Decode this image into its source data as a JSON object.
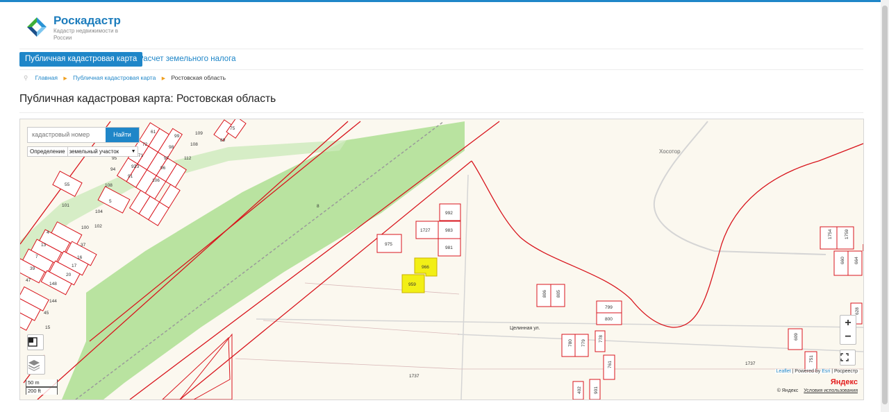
{
  "header": {
    "brand": "Роскадастр",
    "brand_sub": "Кадастр недвижимости в России"
  },
  "tabs": [
    {
      "label": "Публичная кадастровая карта",
      "active": true
    },
    {
      "label": "Расчет земельного налога",
      "active": false
    }
  ],
  "breadcrumb": [
    "Главная",
    "Публичная кадастровая карта",
    "Ростовская область"
  ],
  "page_title": "Публичная кадастровая карта: Ростовская область",
  "map": {
    "search": {
      "placeholder": "кадастровый номер",
      "button": "Найти"
    },
    "define": {
      "label": "Определение",
      "value": "земельный участок"
    },
    "zoom_in": "+",
    "zoom_out": "−",
    "scale_metric": "50 m",
    "scale_imperial": "200 ft",
    "attribution": {
      "leaflet": "Leaflet",
      "sep1": " | Powered by ",
      "esri": "Esri",
      "sep2": " | Росреестр"
    },
    "yandex_logo": "Яндекс",
    "yandex_copy": "© Яндекс",
    "yandex_terms": "Условия использования",
    "place_khosotor": "Хосотор",
    "street": "Целинная ул.",
    "road_number": "8",
    "colors": {
      "parcel_border": "#d8141c",
      "highlight": "#f2ef16",
      "green_belt": "#b9e3a0",
      "background": "#fbf8ef",
      "accent": "#1f86c8"
    },
    "highlighted_parcels": [
      "966",
      "959"
    ],
    "parcels": [
      "992",
      "1727",
      "983",
      "975",
      "981",
      "966",
      "959",
      "806",
      "805",
      "799",
      "800",
      "780",
      "779",
      "778",
      "761",
      "609",
      "751",
      "1737",
      "1737",
      "402",
      "901",
      "1754",
      "1759",
      "660",
      "664",
      "628",
      "55",
      "5",
      "4",
      "13",
      "7",
      "39",
      "47",
      "37",
      "16",
      "17",
      "20",
      "45",
      "15",
      "144",
      "148",
      "108",
      "104",
      "103",
      "102",
      "100",
      "101",
      "99",
      "98",
      "97",
      "96",
      "95",
      "94",
      "93",
      "92",
      "91",
      "109",
      "108",
      "106",
      "112",
      "89",
      "75",
      "61",
      "72",
      "71",
      "73"
    ]
  }
}
